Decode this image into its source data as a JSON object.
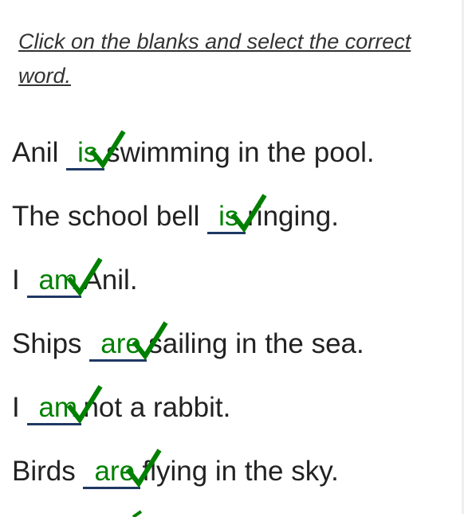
{
  "instruction": "Click on the blanks and select the correct word.",
  "colors": {
    "correct": "#008000",
    "blank_line": "#1f3864",
    "text": "#222222"
  },
  "check_icon": "check-mark-icon",
  "sentences": [
    {
      "before": "Anil ",
      "answer": "is",
      "after": "swimming in the pool.",
      "status": "correct"
    },
    {
      "before": "The school bell ",
      "answer": "is",
      "after": "ringing.",
      "status": "correct"
    },
    {
      "before": "I ",
      "answer": "am",
      "after": "Anil.",
      "status": "correct"
    },
    {
      "before": "Ships ",
      "answer": "are",
      "after": "sailing in the sea.",
      "status": "correct"
    },
    {
      "before": "I ",
      "answer": "am",
      "after": "not a rabbit.",
      "status": "correct"
    },
    {
      "before": "Birds ",
      "answer": "are",
      "after": "flying in the sky.",
      "status": "correct"
    }
  ]
}
